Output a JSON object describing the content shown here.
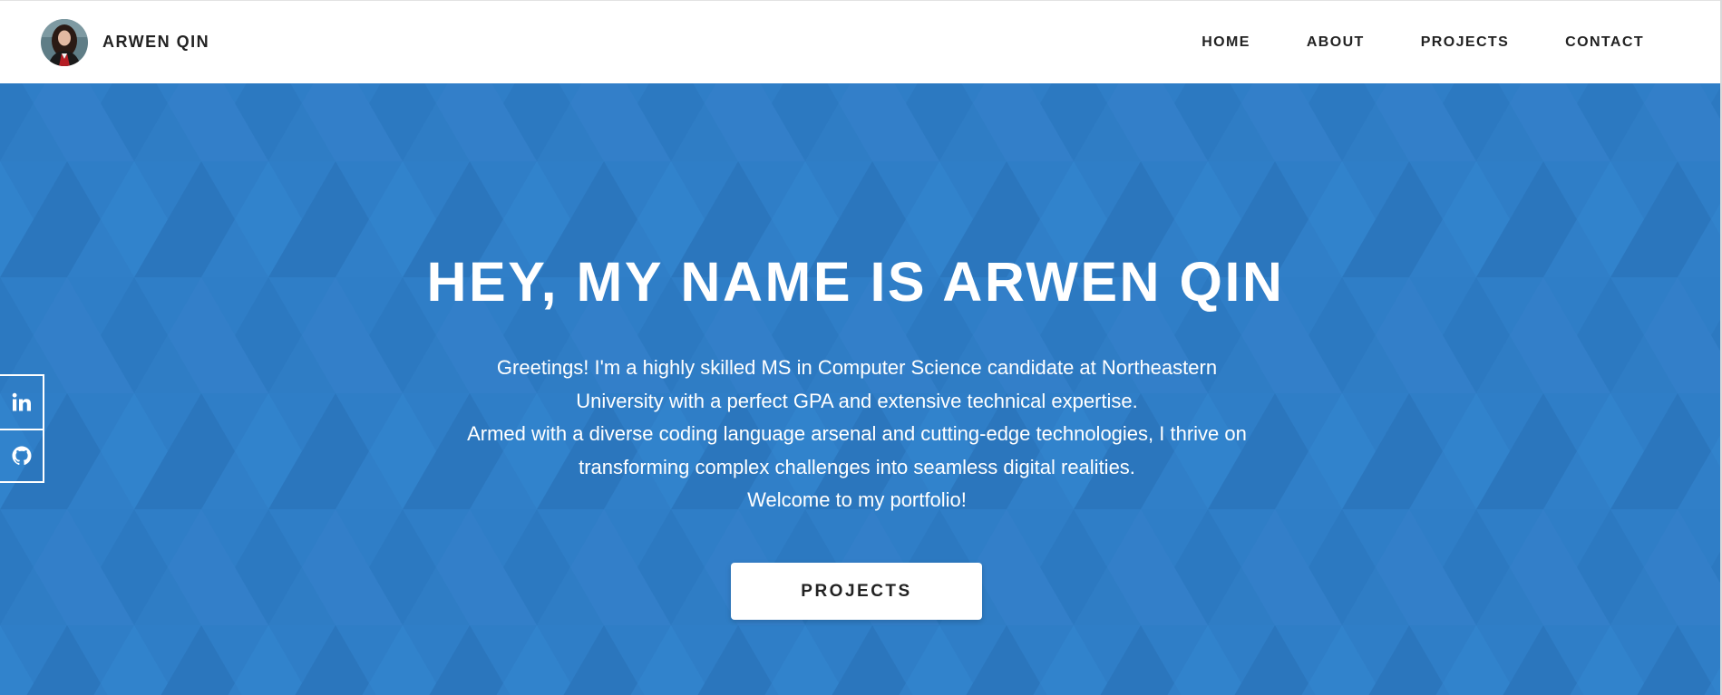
{
  "header": {
    "brand_name": "ARWEN QIN",
    "nav": [
      {
        "label": "HOME"
      },
      {
        "label": "ABOUT"
      },
      {
        "label": "PROJECTS"
      },
      {
        "label": "CONTACT"
      }
    ]
  },
  "hero": {
    "title": "HEY, MY NAME IS ARWEN QIN",
    "paragraphs": [
      "Greetings! I'm a highly skilled MS in Computer Science candidate at Northeastern University with a perfect GPA and extensive technical expertise.",
      "Armed with a diverse coding language arsenal and cutting-edge technologies, I thrive on transforming complex challenges into seamless digital realities.",
      "Welcome to my portfolio!"
    ],
    "button_label": "PROJECTS"
  },
  "social": [
    {
      "icon": "linkedin-icon"
    },
    {
      "icon": "github-icon"
    }
  ],
  "colors": {
    "hero_background": "#2f7ec7",
    "header_background": "#ffffff",
    "text_dark": "#222222",
    "text_light": "#ffffff"
  }
}
